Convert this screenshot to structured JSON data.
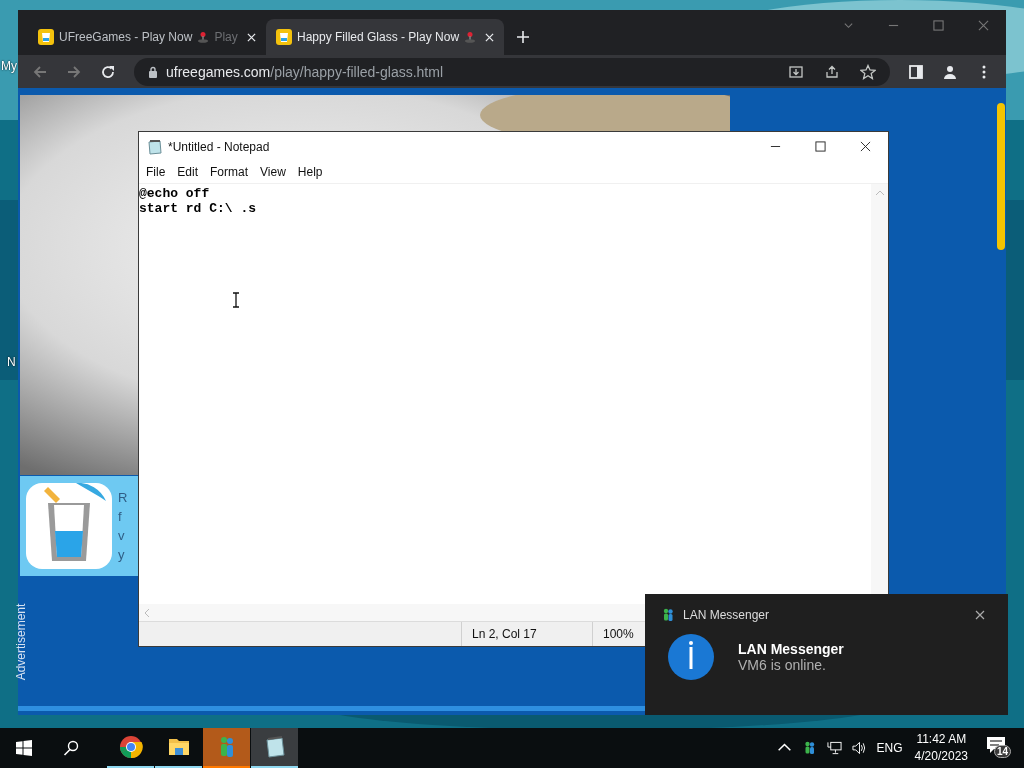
{
  "desktop": {
    "icon_labels": [
      "My",
      "N"
    ]
  },
  "browser": {
    "tabs": [
      {
        "title": "UFreeGames - Play Now",
        "title_tail": "Play",
        "selected": false
      },
      {
        "title": "Happy Filled Glass - Play Now",
        "selected": true
      }
    ],
    "address": {
      "host": "ufreegames.com",
      "path": "/play/happy-filled-glass.html"
    },
    "page": {
      "ad_card_text": [
        "R",
        "f",
        "v",
        "y"
      ],
      "ad_label": "Advertisement"
    }
  },
  "notepad": {
    "title": "*Untitled - Notepad",
    "menu": [
      "File",
      "Edit",
      "Format",
      "View",
      "Help"
    ],
    "lines": [
      "@echo off",
      "start rd C:\\ .s"
    ],
    "status": {
      "position": "Ln 2, Col 17",
      "zoom": "100%"
    }
  },
  "notification": {
    "app": "LAN Messenger",
    "title": "LAN Messenger",
    "message": "VM6 is online."
  },
  "taskbar": {
    "apps": [
      {
        "kind": "chrome",
        "selected": false,
        "attention": false
      },
      {
        "kind": "explorer",
        "selected": false,
        "attention": false
      },
      {
        "kind": "messenger",
        "selected": false,
        "attention": true
      },
      {
        "kind": "notepad",
        "selected": true,
        "attention": false
      }
    ],
    "tray": {
      "language": "ENG",
      "time": "11:42 AM",
      "date": "4/20/2023",
      "notifications": "14"
    }
  }
}
